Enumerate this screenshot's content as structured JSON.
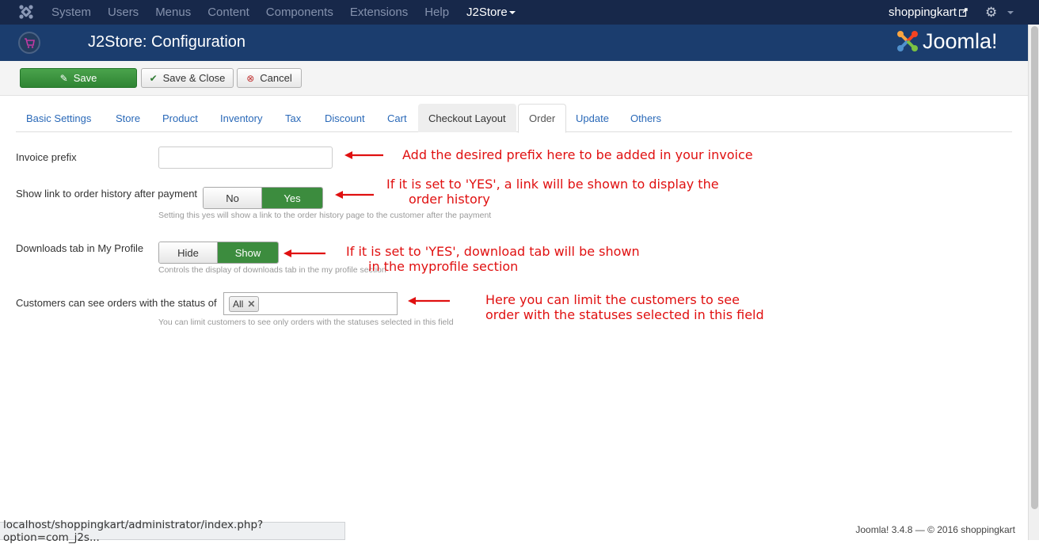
{
  "topnav": {
    "menu": [
      "System",
      "Users",
      "Menus",
      "Content",
      "Components",
      "Extensions",
      "Help"
    ],
    "j2store_menu": "J2Store",
    "site_link": "shoppingkart"
  },
  "header": {
    "title": "J2Store: Configuration",
    "brand": "Joomla!"
  },
  "toolbar": {
    "save": "Save",
    "save_close": "Save & Close",
    "cancel": "Cancel"
  },
  "tabs": [
    "Basic Settings",
    "Store",
    "Product",
    "Inventory",
    "Tax",
    "Discount",
    "Cart",
    "Checkout Layout",
    "Order",
    "Update",
    "Others"
  ],
  "form": {
    "invoice_prefix": {
      "label": "Invoice prefix",
      "value": ""
    },
    "order_history_link": {
      "label": "Show link to order history after payment",
      "off": "No",
      "on": "Yes",
      "help": "Setting this yes will show a link to the order history page to the customer after the payment"
    },
    "downloads_tab": {
      "label": "Downloads tab in My Profile",
      "off": "Hide",
      "on": "Show",
      "help": "Controls the display of downloads tab in the my profile section"
    },
    "order_status": {
      "label": "Customers can see orders with the status of",
      "chip": "All",
      "help": "You can limit customers to see only orders with the statuses selected in this field"
    }
  },
  "annotations": {
    "invoice": "Add the desired prefix here to be added in your invoice",
    "history_1": "If it is set to 'YES', a link will be shown to display the",
    "history_2": "order history",
    "downloads_1": "If it is set to 'YES', download tab will be shown",
    "downloads_2": "in the myprofile section",
    "status_1": "Here you can limit the customers to see",
    "status_2": "order with the statuses selected in this field"
  },
  "statusbar": "localhost/shoppingkart/administrator/index.php?option=com_j2s...",
  "footer": "Joomla! 3.4.8  —  © 2016 shoppingkart",
  "colors": {
    "nav": "#17284a",
    "header": "#1b3d6e",
    "save": "#3c8c3e",
    "annotation": "#e01010",
    "link": "#2a69b8"
  }
}
